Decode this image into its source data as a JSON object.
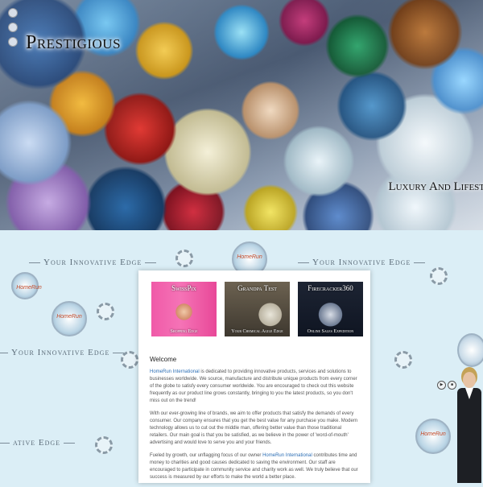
{
  "header": {
    "logo": "Prestigious",
    "tagline": "Luxury And Lifest"
  },
  "background": {
    "ribbon_text": "Your Innovative Edge",
    "ribbon_text_partial": "ative Edge"
  },
  "thumbnails": [
    {
      "title": "SwissPix",
      "subtitle": "Shopping Edge",
      "color": "#f05aa8"
    },
    {
      "title": "Grandpa Test",
      "subtitle": "Your Chemical Agile Edge",
      "color": "#4a4336"
    },
    {
      "title": "Firecracker360",
      "subtitle": "Online Sales Expedition",
      "color": "#1d2433"
    }
  ],
  "content": {
    "welcome": "Welcome",
    "para1_highlight": "HomeRun International",
    "para1": " is dedicated to providing innovative products, services and solutions to businesses worldwide. We source, manufacture and distribute unique products from every corner of the globe to satisfy every consumer worldwide. You are encouraged to check out this website frequently as our product line grows constantly, bringing to you the latest products, so you don't miss out on the trend!",
    "para2": "With our ever-growing line of brands, we aim to offer products that satisfy the demands of every consumer. Our company ensures that you get the best value for any purchase you make. Modern technology allows us to cut out the middle man, offering better value than those traditional retailers. Our main goal is that you be satisfied, as we believe in the power of 'word-of-mouth' advertising and would love to serve you and your friends.",
    "para3_start": "Fueled by growth, our unflagging focus of our owner ",
    "para3_highlight": "HomeRun International",
    "para3_end": " contributes time and money to charities and good causes dedicated to saving the environment. Our staff are encouraged to participate in community service and charity work as well. We truly believe that our success is measured by our efforts to make the world a better place."
  },
  "widgets": {
    "audio_play": "▶",
    "audio_stop": "■"
  }
}
